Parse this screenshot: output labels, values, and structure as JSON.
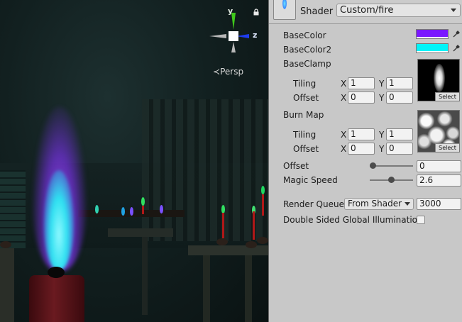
{
  "scene": {
    "axes": {
      "y": "y",
      "z": "z"
    },
    "projection": "Persp",
    "icons": [
      "lock-icon",
      "persp-arrow-icon"
    ],
    "colors": {
      "x_axis": "#f2f2f2",
      "y_axis": "#3ec81a",
      "z_axis": "#1f3cf0",
      "flame_outer": "#8a3cff",
      "flame_inner": "#2ee0f0"
    }
  },
  "inspector": {
    "shader": {
      "label": "Shader",
      "value": "Custom/fire"
    },
    "base_color": {
      "label": "BaseColor",
      "color": "#7a18ff"
    },
    "base_color2": {
      "label": "BaseColor2",
      "color": "#00f4f8"
    },
    "base_clamp": {
      "label": "BaseClamp",
      "tiling": {
        "label": "Tiling",
        "x_label": "X",
        "x": "1",
        "y_label": "Y",
        "y": "1"
      },
      "offset": {
        "label": "Offset",
        "x_label": "X",
        "x": "0",
        "y_label": "Y",
        "y": "0"
      },
      "select_label": "Select"
    },
    "burn_map": {
      "label": "Burn Map",
      "tiling": {
        "label": "Tiling",
        "x_label": "X",
        "x": "1",
        "y_label": "Y",
        "y": "1"
      },
      "offset": {
        "label": "Offset",
        "x_label": "X",
        "x": "0",
        "y_label": "Y",
        "y": "0"
      },
      "select_label": "Select"
    },
    "offset": {
      "label": "Offset",
      "value": "0",
      "fraction": 0.0
    },
    "magic_speed": {
      "label": "Magic Speed",
      "value": "2.6",
      "fraction": 0.5
    },
    "render_queue": {
      "label": "Render Queue",
      "mode": "From Shader",
      "value": "3000"
    },
    "double_sided_gi": {
      "label": "Double Sided Global Illumination",
      "checked": false
    }
  }
}
